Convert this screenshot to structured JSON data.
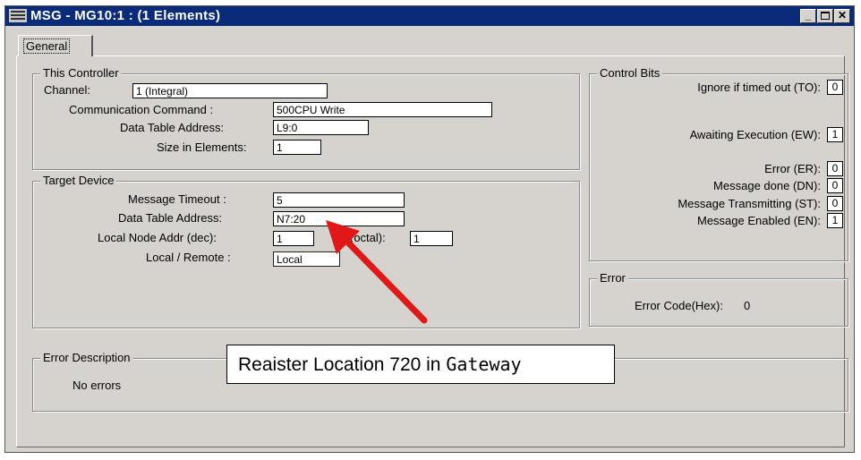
{
  "window": {
    "title": "MSG - MG10:1 : (1 Elements)",
    "icons": {
      "app": "message-config-icon",
      "minimize": "minimize-icon",
      "maximize": "maximize-icon",
      "close": "close-icon"
    }
  },
  "tabs": [
    {
      "label": "General",
      "active": true
    }
  ],
  "this_controller": {
    "legend": "This Controller",
    "channel_label": "Channel:",
    "channel_value": "1 (Integral)",
    "comm_command_label": "Communication Command :",
    "comm_command_value": "500CPU Write",
    "data_table_address_label": "Data Table Address:",
    "data_table_address_value": "L9:0",
    "size_label": "Size in Elements:",
    "size_value": "1"
  },
  "target_device": {
    "legend": "Target Device",
    "timeout_label": "Message Timeout :",
    "timeout_value": "5",
    "data_table_address_label": "Data Table Address:",
    "data_table_address_value": "N7:20",
    "local_node_label": "Local Node Addr (dec):",
    "local_node_value": "1",
    "octal_label": "(octal):",
    "octal_value": "1",
    "local_remote_label": "Local / Remote :",
    "local_remote_value": "Local"
  },
  "control_bits": {
    "legend": "Control Bits",
    "items": [
      {
        "label": "Ignore if timed out (TO):",
        "value": "0"
      },
      {
        "label": "Awaiting Execution (EW):",
        "value": "1"
      },
      {
        "label": "Error (ER):",
        "value": "0"
      },
      {
        "label": "Message done (DN):",
        "value": "0"
      },
      {
        "label": "Message Transmitting (ST):",
        "value": "0"
      },
      {
        "label": "Message Enabled (EN):",
        "value": "1"
      }
    ]
  },
  "error": {
    "legend": "Error",
    "code_label": "Error Code(Hex):",
    "code_value": "0"
  },
  "error_description": {
    "legend": "Error Description",
    "text": "No errors"
  },
  "annotation": {
    "text_prefix": "Reaister Location 720 in ",
    "text_mono": "Gateway",
    "arrow_color": "#e01818"
  }
}
